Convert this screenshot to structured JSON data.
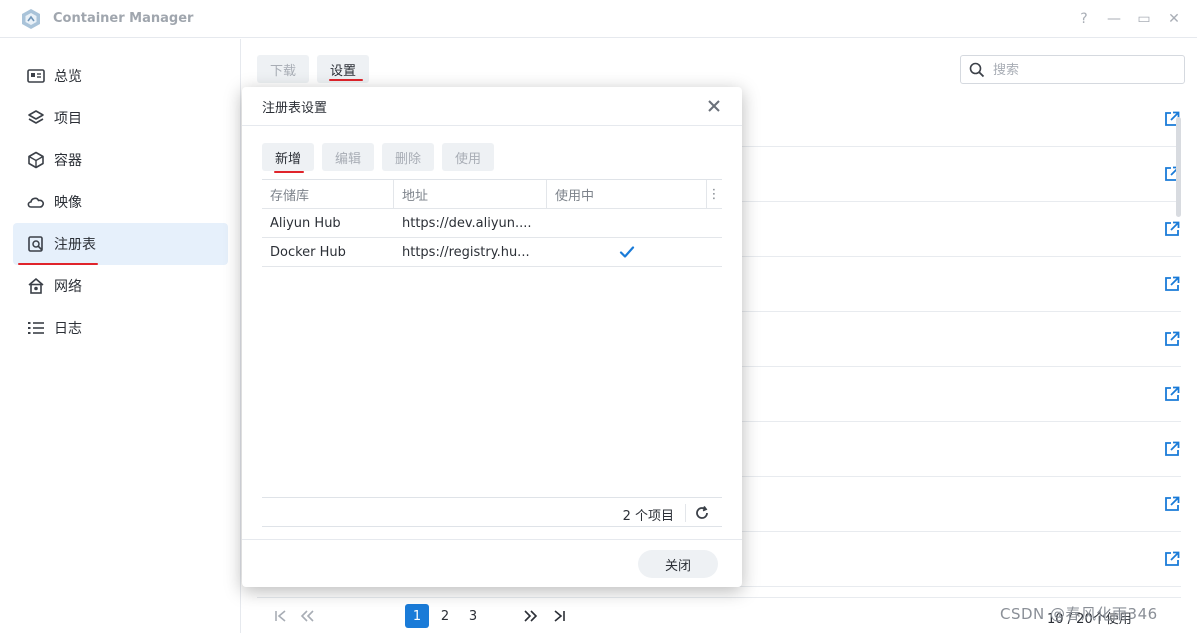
{
  "app": {
    "title": "Container Manager"
  },
  "window_controls": {
    "help": "?",
    "minimize": "—",
    "maximize": "▭",
    "close": "✕"
  },
  "sidebar": {
    "items": [
      {
        "label": "总览",
        "icon": "dashboard-icon"
      },
      {
        "label": "项目",
        "icon": "layers-icon"
      },
      {
        "label": "容器",
        "icon": "cube-icon"
      },
      {
        "label": "映像",
        "icon": "cloud-icon"
      },
      {
        "label": "注册表",
        "icon": "registry-search-icon",
        "active": true
      },
      {
        "label": "网络",
        "icon": "home-network-icon"
      },
      {
        "label": "日志",
        "icon": "list-icon"
      }
    ]
  },
  "toolbar": {
    "download_label": "下载",
    "settings_label": "设置"
  },
  "search": {
    "placeholder": "搜索"
  },
  "pager": {
    "pages": [
      "1",
      "2",
      "3"
    ],
    "current": "1",
    "count_text": "10 / 20个使用"
  },
  "watermark": "CSDN @春风化雨346",
  "dialog": {
    "title": "注册表设置",
    "buttons": {
      "add": "新增",
      "edit": "编辑",
      "delete": "删除",
      "use": "使用"
    },
    "columns": [
      "存储库",
      "地址",
      "使用中"
    ],
    "rows": [
      {
        "repo": "Aliyun Hub",
        "address": "https://dev.aliyun....",
        "in_use": false
      },
      {
        "repo": "Docker Hub",
        "address": "https://registry.hu...",
        "in_use": true
      }
    ],
    "item_count": "2 个项目",
    "close_label": "关闭"
  },
  "colors": {
    "accent": "#1a7bd8",
    "active_bg": "#e6f0fb",
    "annotation_red": "#e0242b"
  }
}
